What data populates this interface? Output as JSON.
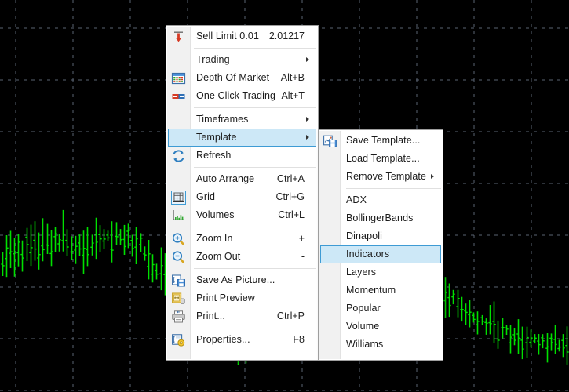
{
  "window": {
    "title": "MetaTrader chart context menu",
    "background_color": "#000000",
    "grid_color": "#5a6472",
    "bar_color": "#00e000"
  },
  "chart_data": {
    "type": "bar",
    "title": "",
    "xlabel": "",
    "ylabel": "",
    "grid": true,
    "legend": null,
    "note": "OHLC bar (vertical tick) price chart, green bars on black background with dashed grid",
    "grid_spacing_x": 73,
    "grid_spacing_y": 66,
    "price_tick_label": "2.01217",
    "series": [
      {
        "name": "price",
        "values": [
          331,
          330,
          326,
          323,
          324,
          320,
          316,
          312,
          310,
          313,
          306,
          307,
          310,
          312,
          305,
          300,
          312,
          318,
          322,
          317,
          314,
          310,
          307,
          303,
          298,
          300,
          305,
          302,
          299,
          296,
          300,
          303,
          307,
          311,
          317,
          323,
          331,
          338,
          341,
          345,
          349,
          352,
          356,
          358,
          362,
          372,
          378,
          382,
          386,
          390,
          394,
          399,
          404,
          409,
          418,
          425,
          431,
          436,
          440,
          444,
          441,
          437,
          433,
          428,
          423,
          418,
          412,
          407,
          402,
          397,
          392,
          386,
          381,
          376,
          371,
          366,
          361,
          355,
          349,
          344,
          339,
          334,
          329,
          323,
          318,
          313,
          308,
          303,
          298,
          292,
          288,
          284,
          290,
          296,
          301,
          306,
          312,
          317,
          322,
          327,
          333,
          338,
          343,
          348,
          353,
          358,
          363,
          367,
          371,
          375,
          379,
          383,
          387,
          391,
          394,
          398,
          401,
          404,
          407,
          410,
          413,
          416,
          419,
          422,
          424,
          426,
          428,
          430,
          431,
          433,
          434,
          435,
          436,
          437,
          438,
          438,
          439,
          439,
          440,
          440
        ]
      }
    ]
  },
  "context_menu": {
    "items": [
      {
        "id": "sell-limit",
        "label": "Sell Limit 0.01",
        "accel": "2.01217",
        "icon": "sell-arrow-icon",
        "arrow": false,
        "separator_after": true
      },
      {
        "id": "trading",
        "label": "Trading",
        "accel": "",
        "icon": "",
        "arrow": true,
        "separator_after": false
      },
      {
        "id": "depth-of-market",
        "label": "Depth Of Market",
        "accel": "Alt+B",
        "icon": "depth-of-market-icon",
        "arrow": false,
        "separator_after": false
      },
      {
        "id": "one-click-trading",
        "label": "One Click Trading",
        "accel": "Alt+T",
        "icon": "one-click-trading-icon",
        "arrow": false,
        "separator_after": true
      },
      {
        "id": "timeframes",
        "label": "Timeframes",
        "accel": "",
        "icon": "",
        "arrow": true,
        "separator_after": false
      },
      {
        "id": "template",
        "label": "Template",
        "accel": "",
        "icon": "",
        "arrow": true,
        "separator_after": false,
        "selected": true
      },
      {
        "id": "refresh",
        "label": "Refresh",
        "accel": "",
        "icon": "refresh-icon",
        "arrow": false,
        "separator_after": true
      },
      {
        "id": "auto-arrange",
        "label": "Auto Arrange",
        "accel": "Ctrl+A",
        "icon": "",
        "arrow": false,
        "separator_after": false
      },
      {
        "id": "grid",
        "label": "Grid",
        "accel": "Ctrl+G",
        "icon": "grid-icon",
        "arrow": false,
        "separator_after": false
      },
      {
        "id": "volumes",
        "label": "Volumes",
        "accel": "Ctrl+L",
        "icon": "volumes-icon",
        "arrow": false,
        "separator_after": true
      },
      {
        "id": "zoom-in",
        "label": "Zoom In",
        "accel": "+",
        "icon": "zoom-in-icon",
        "arrow": false,
        "separator_after": false
      },
      {
        "id": "zoom-out",
        "label": "Zoom Out",
        "accel": "-",
        "icon": "zoom-out-icon",
        "arrow": false,
        "separator_after": true
      },
      {
        "id": "save-as-picture",
        "label": "Save As Picture...",
        "accel": "",
        "icon": "save-picture-icon",
        "arrow": false,
        "separator_after": false
      },
      {
        "id": "print-preview",
        "label": "Print Preview",
        "accel": "",
        "icon": "print-preview-icon",
        "arrow": false,
        "separator_after": false
      },
      {
        "id": "print",
        "label": "Print...",
        "accel": "Ctrl+P",
        "icon": "print-icon",
        "arrow": false,
        "separator_after": true
      },
      {
        "id": "properties",
        "label": "Properties...",
        "accel": "F8",
        "icon": "properties-icon",
        "arrow": false,
        "separator_after": false
      }
    ]
  },
  "template_submenu": {
    "items": [
      {
        "id": "save-template",
        "label": "Save Template...",
        "icon": "save-template-icon",
        "arrow": false,
        "separator_after": false
      },
      {
        "id": "load-template",
        "label": "Load Template...",
        "icon": "",
        "arrow": false,
        "separator_after": false
      },
      {
        "id": "remove-template",
        "label": "Remove Template",
        "icon": "",
        "arrow": true,
        "separator_after": true
      },
      {
        "id": "adx",
        "label": "ADX",
        "icon": "",
        "arrow": false,
        "separator_after": false
      },
      {
        "id": "bollingerbands",
        "label": "BollingerBands",
        "icon": "",
        "arrow": false,
        "separator_after": false
      },
      {
        "id": "dinapoli",
        "label": "Dinapoli",
        "icon": "",
        "arrow": false,
        "separator_after": false
      },
      {
        "id": "indicators",
        "label": "Indicators",
        "icon": "",
        "arrow": false,
        "separator_after": false,
        "selected": true
      },
      {
        "id": "layers",
        "label": "Layers",
        "icon": "",
        "arrow": false,
        "separator_after": false
      },
      {
        "id": "momentum",
        "label": "Momentum",
        "icon": "",
        "arrow": false,
        "separator_after": false
      },
      {
        "id": "popular",
        "label": "Popular",
        "icon": "",
        "arrow": false,
        "separator_after": false
      },
      {
        "id": "volume",
        "label": "Volume",
        "icon": "",
        "arrow": false,
        "separator_after": false
      },
      {
        "id": "williams",
        "label": "Williams",
        "icon": "",
        "arrow": false,
        "separator_after": false
      }
    ]
  },
  "colors": {
    "menu_background": "#ffffff",
    "menu_gutter": "#f1f1f1",
    "selection_fill": "#cde8f7",
    "selection_border": "#3e9bd4",
    "chart_background": "#000000",
    "chart_bars": "#00e000",
    "chart_grid": "#5a6472"
  }
}
